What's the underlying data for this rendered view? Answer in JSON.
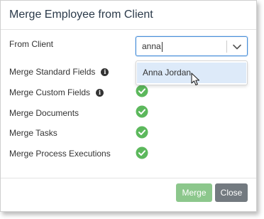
{
  "dialog": {
    "title": "Merge Employee from Client",
    "from_client": {
      "label": "From Client",
      "value": "anna",
      "options": [
        "Anna Jordan"
      ]
    },
    "rows": [
      {
        "label": "Merge Standard Fields",
        "info": true,
        "checked": true
      },
      {
        "label": "Merge Custom Fields",
        "info": true,
        "checked": true
      },
      {
        "label": "Merge Documents",
        "info": false,
        "checked": true
      },
      {
        "label": "Merge Tasks",
        "info": false,
        "checked": true
      },
      {
        "label": "Merge Process Executions",
        "info": false,
        "checked": true
      }
    ],
    "buttons": {
      "merge": "Merge",
      "close": "Close"
    }
  },
  "colors": {
    "check": "#5cb85c",
    "merge_button": "#8cc78c",
    "close_button": "#737a80",
    "focus_border": "#4a90d9",
    "option_highlight": "#ddeaf9"
  },
  "icons": {
    "info": "info-circle-icon",
    "check": "check-circle-icon",
    "dropdown": "chevron-down-icon",
    "pointer": "mouse-pointer-icon"
  }
}
